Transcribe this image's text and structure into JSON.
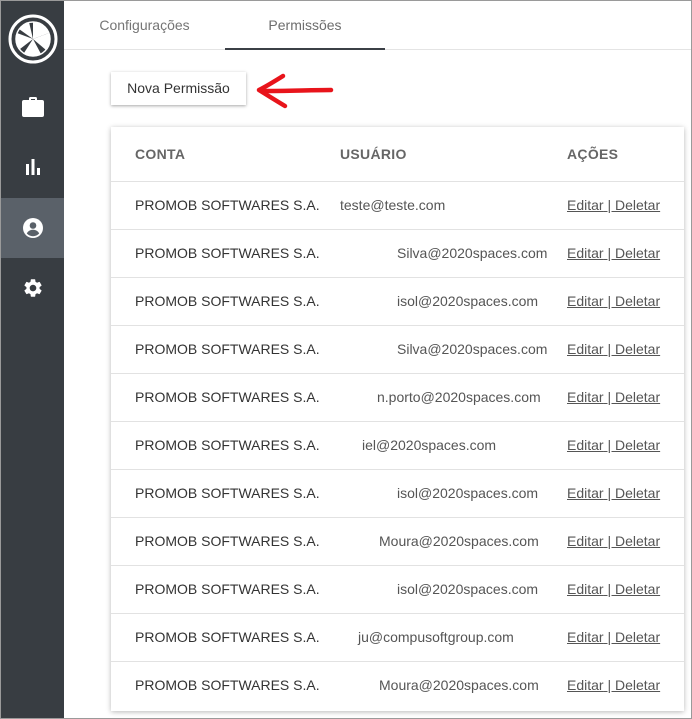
{
  "tabs": [
    {
      "label": "Configurações"
    },
    {
      "label": "Permissões"
    }
  ],
  "new_button_label": "Nova Permissão",
  "table": {
    "headers": {
      "conta": "CONTA",
      "usuario": "USUÁRIO",
      "acoes": "AÇÕES"
    },
    "edit_label": "Editar",
    "separator": "|",
    "delete_label": "Deletar",
    "rows": [
      {
        "conta": "PROMOB SOFTWARES S.A.",
        "usuario": "teste@teste.com"
      },
      {
        "conta": "PROMOB SOFTWARES S.A.",
        "usuario": "Silva@2020spaces.com"
      },
      {
        "conta": "PROMOB SOFTWARES S.A.",
        "usuario": "isol@2020spaces.com"
      },
      {
        "conta": "PROMOB SOFTWARES S.A.",
        "usuario": "Silva@2020spaces.com"
      },
      {
        "conta": "PROMOB SOFTWARES S.A.",
        "usuario": "n.porto@2020spaces.com"
      },
      {
        "conta": "PROMOB SOFTWARES S.A.",
        "usuario": "iel@2020spaces.com"
      },
      {
        "conta": "PROMOB SOFTWARES S.A.",
        "usuario": "isol@2020spaces.com"
      },
      {
        "conta": "PROMOB SOFTWARES S.A.",
        "usuario": "Moura@2020spaces.com"
      },
      {
        "conta": "PROMOB SOFTWARES S.A.",
        "usuario": "isol@2020spaces.com"
      },
      {
        "conta": "PROMOB SOFTWARES S.A.",
        "usuario": "ju@compusoftgroup.com"
      },
      {
        "conta": "PROMOB SOFTWARES S.A.",
        "usuario": "Moura@2020spaces.com"
      }
    ]
  },
  "sidebar": {
    "items": [
      {
        "icon": "briefcase-icon"
      },
      {
        "icon": "bar-chart-icon"
      },
      {
        "icon": "account-circle-icon",
        "active": true
      },
      {
        "icon": "gear-icon"
      }
    ]
  },
  "colors": {
    "sidebar_bg": "#383d42",
    "sidebar_active": "#5a6169",
    "annotation_arrow": "#e8141b"
  }
}
